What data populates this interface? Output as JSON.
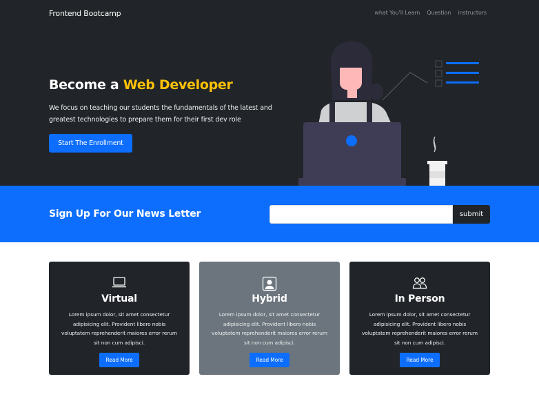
{
  "navbar": {
    "brand": "Frontend Bootcamp",
    "links": [
      "what You'll Learn",
      "Question",
      "instructors"
    ]
  },
  "hero": {
    "title_prefix": "Become a ",
    "title_accent": "Web Developer",
    "description": "We focus on teaching our students the fundamentals of the latest and greatest technologies to prepare them for their first dev role",
    "cta_label": "Start The Enrollment"
  },
  "newsletter": {
    "title": "Sign Up For Our News Letter",
    "input_value": "",
    "submit_label": "submit"
  },
  "cards": [
    {
      "icon": "laptop-icon",
      "title": "Virtual",
      "text": "Lorem ipsum dolor, sit amet consectetur adipisicing elit. Provident libero nobis voluptatem reprehenderit maiores error rerum sit non cum adipisci.",
      "button": "Read More"
    },
    {
      "icon": "person-badge-icon",
      "title": "Hybrid",
      "text": "Lorem ipsum dolor, sit amet consectetur adipisicing elit. Provident libero nobis voluptatem reprehenderit maiores error rerum sit non cum adipisci.",
      "button": "Read More"
    },
    {
      "icon": "people-icon",
      "title": "In Person",
      "text": "Lorem ipsum dolor, sit amet consectetur adipisicing elit. Provident libero nobis voluptatem reprehenderit maiores error rerum sit non cum adipisci.",
      "button": "Read More"
    }
  ],
  "colors": {
    "dark": "#212529",
    "primary": "#0d6efd",
    "accent": "#ffc107",
    "gray": "#6c757d"
  }
}
